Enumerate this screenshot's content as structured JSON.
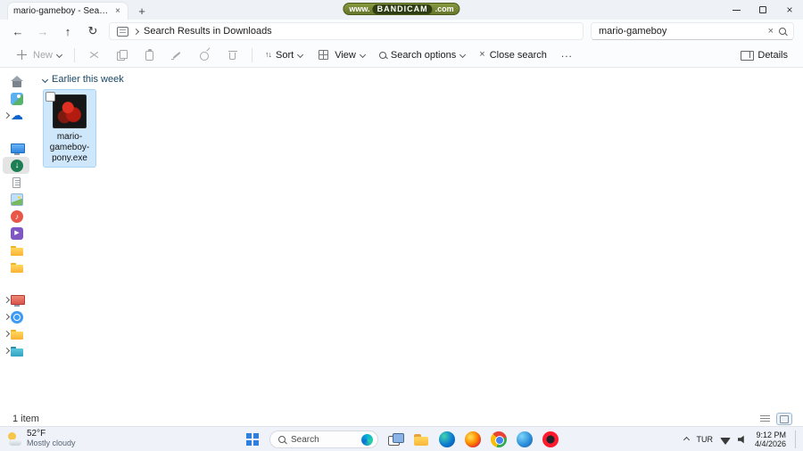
{
  "colors": {
    "accent": "#0067c0",
    "selection": "#cfe7fa",
    "taskbar_bg": "#eff3f9",
    "watermark_green": "#66762c"
  },
  "titlebar": {
    "tab_title": "mario-gameboy - Search Res",
    "watermark": {
      "prefix": "www.",
      "brand": "BANDICAM",
      "suffix": ".com"
    }
  },
  "navbar": {
    "breadcrumb": "Search Results in Downloads",
    "search_value": "mario-gameboy"
  },
  "toolbar": {
    "new": "New",
    "sort": "Sort",
    "view": "View",
    "search_options": "Search options",
    "close_search": "Close search",
    "more": "...",
    "details": "Details"
  },
  "sidebar": {
    "items": [
      {
        "name": "home",
        "icon": "home",
        "chevron": false
      },
      {
        "name": "gallery",
        "icon": "gallery",
        "chevron": false
      },
      {
        "name": "onedrive",
        "icon": "onedrive",
        "chevron": true
      },
      {
        "name": "desktop",
        "icon": "desktop",
        "chevron": false,
        "gap_before": true
      },
      {
        "name": "downloads",
        "icon": "downloads",
        "chevron": false,
        "selected": true
      },
      {
        "name": "documents",
        "icon": "documents",
        "chevron": false
      },
      {
        "name": "pictures",
        "icon": "pictures",
        "chevron": false
      },
      {
        "name": "music",
        "icon": "music",
        "chevron": false
      },
      {
        "name": "videos",
        "icon": "videos",
        "chevron": false
      },
      {
        "name": "folder-1",
        "icon": "folder",
        "chevron": false
      },
      {
        "name": "folder-2",
        "icon": "folder",
        "chevron": false
      },
      {
        "name": "this-pc",
        "icon": "this-pc",
        "chevron": true,
        "gap_before": true
      },
      {
        "name": "network",
        "icon": "network",
        "chevron": true
      },
      {
        "name": "folder-3",
        "icon": "folder",
        "chevron": true
      },
      {
        "name": "folder-4",
        "icon": "folder-blue",
        "chevron": true
      }
    ]
  },
  "content": {
    "group_header": "Earlier this week",
    "file_name": "mario-gameboy-pony.exe"
  },
  "statusbar": {
    "count": "1 item"
  },
  "taskbar": {
    "weather_temp": "52°F",
    "weather_desc": "Mostly cloudy",
    "search_label": "Search",
    "apps": [
      {
        "name": "task-view",
        "icon": "taskview"
      },
      {
        "name": "file-explorer",
        "icon": "explorer"
      },
      {
        "name": "edge",
        "icon": "edge"
      },
      {
        "name": "firefox",
        "icon": "firefox"
      },
      {
        "name": "chrome",
        "icon": "chrome"
      },
      {
        "name": "edge-beta",
        "icon": "edge2"
      },
      {
        "name": "opera",
        "icon": "opera"
      }
    ],
    "tray_lang": "TUR",
    "time": "9:12 PM",
    "date": "4/4/2026"
  }
}
